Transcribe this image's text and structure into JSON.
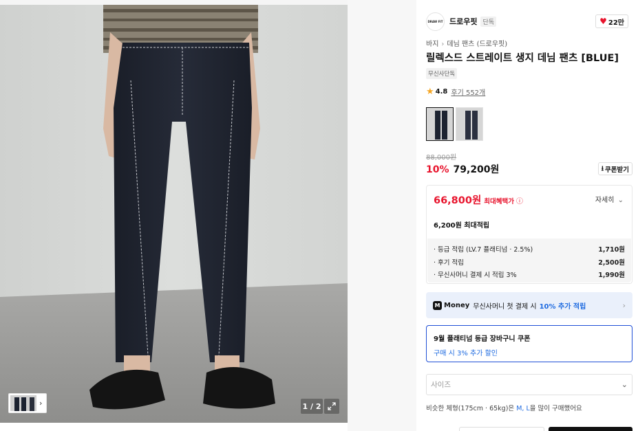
{
  "gallery": {
    "counter": "1 / 2"
  },
  "brand": {
    "logo_text": "DRAW FIT",
    "name": "드로우핏",
    "tag": "단독",
    "likes": "22만"
  },
  "breadcrumb": [
    "바지",
    "데님 팬츠 (드로우핏)"
  ],
  "product": {
    "title": "릴렉스드 스트레이트 생지 데님 팬츠 [BLUE]",
    "exclusive_badge": "무신사단독",
    "rating": "4.8",
    "reviews": "후기 552개"
  },
  "pricing": {
    "original": "88,000원",
    "discount": "10%",
    "price": "79,200원",
    "coupon_button": "쿠폰받기"
  },
  "benefit": {
    "max_price": "66,800원",
    "max_label": "최대혜택가",
    "detail_label": "자세히",
    "points_total": "6,200원 최대적립",
    "points": [
      {
        "label": "· 등급 적립 (LV.7 플래티넘 · 2.5%)",
        "amount": "1,710원"
      },
      {
        "label": "· 후기 적립",
        "amount": "2,500원"
      },
      {
        "label": "· 무신사머니 결제 시 적립 3%",
        "amount": "1,990원"
      }
    ]
  },
  "money_banner": {
    "logo": "M",
    "brand": "Money",
    "text": "무신사머니 첫 결제 시",
    "highlight": "10% 추가 적립"
  },
  "coupon_box": {
    "title": "9월 플래티넘 등급 장바구니 쿠폰",
    "subtitle": "구매 시 3% 추가 할인"
  },
  "size": {
    "placeholder": "사이즈",
    "note_prefix": "비슷한 체형(175cm · 65kg)은",
    "note_sizes": "M, L",
    "note_suffix": "을 많이 구매했어요"
  },
  "colors": {
    "accent_red": "#e8142d",
    "accent_blue": "#1f6be0"
  }
}
